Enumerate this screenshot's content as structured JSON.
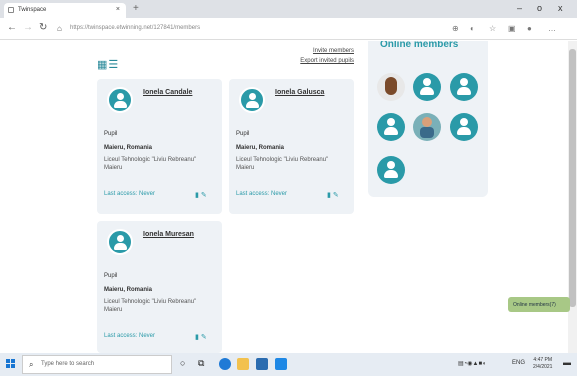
{
  "browser": {
    "tab_title": "Twinspace",
    "new_tab": "+",
    "url": "https://twinspace.etwinning.net/127841/members",
    "window_buttons": [
      "–",
      "o",
      "x"
    ]
  },
  "toolbar": {
    "invite_members": "Invite members",
    "export_invited": "Export invited pupils",
    "view_icons": "grid-view-icon list-view-icon"
  },
  "members": [
    {
      "name": "Ionela Candale",
      "role": "Pupil",
      "location": "Maieru, Romania",
      "school": "Liceul Tehnologic \"Liviu Rebreanu\" Maieru",
      "access": "Last access: Never"
    },
    {
      "name": "Ionela Galusca",
      "role": "Pupil",
      "location": "Maieru, Romania",
      "school": "Liceul Tehnologic \"Liviu Rebreanu\" Maieru",
      "access": "Last access: Never"
    },
    {
      "name": "Ionela Muresan",
      "role": "Pupil",
      "location": "Maieru, Romania",
      "school": "Liceul Tehnologic \"Liviu Rebreanu\" Maieru",
      "access": "Last access: Never"
    }
  ],
  "online_panel": {
    "title": "Online members",
    "tab_label": "Online members(7)"
  },
  "taskbar": {
    "search_placeholder": "Type here to search",
    "time": "4:47 PM",
    "date": "2/4/2021",
    "lang": "ENG"
  },
  "colors": {
    "accent": "#2a9aa8",
    "online_tab": "#a8c886"
  }
}
